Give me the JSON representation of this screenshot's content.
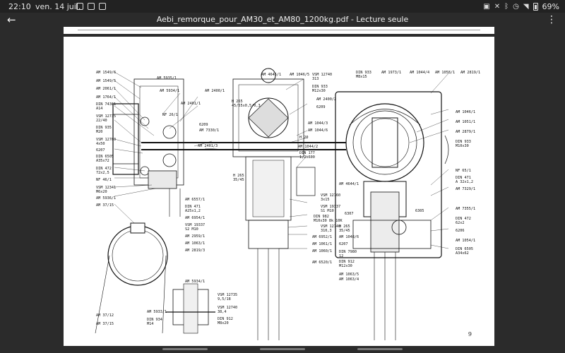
{
  "status_bar": {
    "time": "22:10",
    "date": "ven. 14 juil.",
    "battery": "69%"
  },
  "app_bar": {
    "title": "Aebi_remorque_pour_AM30_et_AM80_1200kg.pdf - Lecture seule",
    "back_icon": "back-arrow-icon",
    "menu_icon": "more-vertical-icon"
  },
  "page": {
    "page_number": "9",
    "labels": {
      "l01": "AM 1549/6",
      "l02": "AM 5935/1",
      "l03": "AM 1549/5",
      "l04": "AM 5934/1",
      "l05": "AM 2061/1",
      "l06": "AM 2400/1",
      "l07": "AM 1764/1",
      "l08": "DIN 74361",
      "l09": "A14",
      "l10": "AM 2401/1",
      "l11": "NF 26/1",
      "l12": "VSM 12735",
      "l13": "22/40",
      "l14": "DIN 935",
      "l15": "M20",
      "l16": "VSM 12760",
      "l17": "4x50",
      "l18": "6207",
      "l19": "DIN 6505",
      "l20": "A35x72",
      "l21": "DIN 472",
      "l22": "72x2,5",
      "l23": "NF 46/1",
      "l24": "VSM 12341",
      "l25": "M6x20",
      "l26": "AM 5936/1",
      "l27": "AM 37/15",
      "l28": "AM 37/12",
      "l29": "AM 37/15",
      "l30": "AM 4645/1",
      "l31": "AM 1046/5",
      "l32": "VSM 12740",
      "l33": "313",
      "l34": "DIN 933",
      "l35": "M12x30",
      "l36": "AM 2400/2",
      "l37": "H 265",
      "l38": "45/55x0,5/0,3",
      "l39": "6209",
      "l40": "6209",
      "l41": "AM 7330/1",
      "l42": "AM 1044/3",
      "l43": "AM 1044/6",
      "l44": "H 20",
      "l45": "AM 2401/3",
      "l46": "AM 1044/2",
      "l47": "DIN 177",
      "l48": "1,2x600",
      "l49": "H 265",
      "l50": "35/45",
      "l51": "AM 6557/1",
      "l52": "DIN 471",
      "l53": "A25x1,2",
      "l54": "AM 6954/1",
      "l55": "VSM 19337",
      "l56": "S2 M10",
      "l57": "AM 2959/1",
      "l58": "AM 1063/1",
      "l59": "AM 2819/3",
      "l60": "VSM 12760",
      "l61": "3x15",
      "l62": "VSM 19337",
      "l63": "S1 M10",
      "l64": "DIN 982",
      "l65": "M10x30 8k 10K",
      "l66": "VSM 12740",
      "l67": "310,3",
      "l68": "H 265",
      "l69": "35/45",
      "l70": "AM 6952/1",
      "l71": "AM 1061/1",
      "l72": "AM 1060/1",
      "l73": "AM 6520/1",
      "l74": "DIN 933",
      "l75": "M8x15",
      "l76": "AM 1973/1",
      "l77": "AM 1044/4",
      "l78": "AM 1058/1",
      "l79": "AM 2819/1",
      "l80": "AM 1046/1",
      "l81": "AM 1051/1",
      "l82": "AM 2879/1",
      "l83": "DIN 933",
      "l84": "M10x30",
      "l85": "NF 65/1",
      "l86": "DIN 471",
      "l87": "A 32x1,2",
      "l88": "AM 4644/1",
      "l89": "AM 7329/1",
      "l90": "6307",
      "l91": "6305",
      "l92": "AM 7355/1",
      "l93": "DIN 472",
      "l94": "62x2",
      "l95": "6206",
      "l96": "AM 1048/6",
      "l97": "6207",
      "l98": "AM 1054/1",
      "l99": "DIN 6505",
      "l100": "A34x62",
      "l101": "DIN 7980",
      "l102": "12",
      "l103": "DIN 912",
      "l104": "M12x30",
      "l105": "AM 1063/5",
      "l106": "AM 1063/4",
      "l107": "AM 5934/1",
      "l108": "VSM 12735",
      "l109": "9,5/18",
      "l110": "AM 5933/1",
      "l111": "VSM 12740",
      "l112": "38,4",
      "l113": "DIN 934",
      "l114": "M14",
      "l115": "DIN 912",
      "l116": "M8x20"
    }
  }
}
